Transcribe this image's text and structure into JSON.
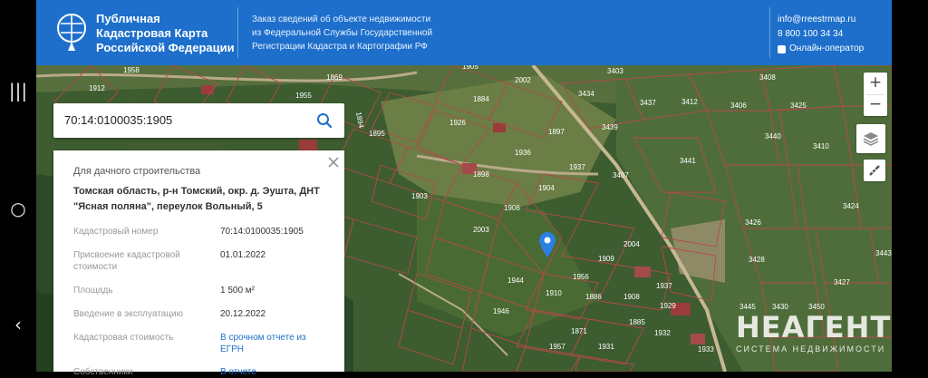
{
  "header": {
    "title_lines": [
      "Публичная",
      "Кадастровая Карта",
      "Российской Федерации"
    ],
    "order_lines": [
      "Заказ сведений об объекте недвижимости",
      "из Федеральной Службы Государственной",
      "Регистрации Кадастра и Картографии РФ"
    ],
    "email": "info@rreestrmap.ru",
    "phone": "8 800 100 34 34",
    "chat": "Онлайн-оператор"
  },
  "search": {
    "value": "70:14:0100035:1905"
  },
  "card": {
    "type": "Для дачного строительства",
    "address": "Томская область, р-н Томский, окр. д. Эушта, ДНТ \"Ясная поляна\", переулок Вольный, 5",
    "rows": [
      {
        "label": "Кадастровый номер",
        "value": "70:14:0100035:1905"
      },
      {
        "label": "Присвоение кадастровой стоимости",
        "value": "01.01.2022"
      },
      {
        "label": "Площадь",
        "value": "1 500 м²"
      },
      {
        "label": "Введение в эксплуатацию",
        "value": "20.12.2022"
      },
      {
        "label": "Кадастровая стоимость",
        "value": "В срочном отчете из ЕГРН"
      },
      {
        "label": "Собственники",
        "value": "В отчете"
      }
    ]
  },
  "map": {
    "parcels": [
      "1958",
      "1912",
      "1869",
      "1905",
      "1955",
      "2002",
      "3403",
      "3408",
      "3434",
      "3437",
      "3412",
      "3406",
      "3425",
      "1894",
      "1926",
      "1884",
      "3439",
      "3440",
      "1895",
      "1897",
      "3410",
      "1898",
      "1936",
      "3441",
      "1937",
      "1903",
      "1904",
      "3407",
      "3426",
      "1906",
      "3424",
      "2003",
      "3428",
      "3443",
      "1944",
      "1956",
      "1909",
      "2004",
      "3427",
      "1946",
      "1910",
      "1908",
      "1937",
      "1886",
      "3445",
      "3430",
      "3450",
      "1871",
      "1885",
      "1929",
      "1957",
      "1931",
      "1932",
      "1933"
    ],
    "zoom_in": "+",
    "zoom_out": "−"
  },
  "watermark": {
    "logo": "НЕАГЕНТ",
    "sub": "СИСТЕМА НЕДВИЖИМОСТИ"
  },
  "colors": {
    "brand_blue": "#1d6fcb",
    "parcel_line": "#b44a4a"
  }
}
